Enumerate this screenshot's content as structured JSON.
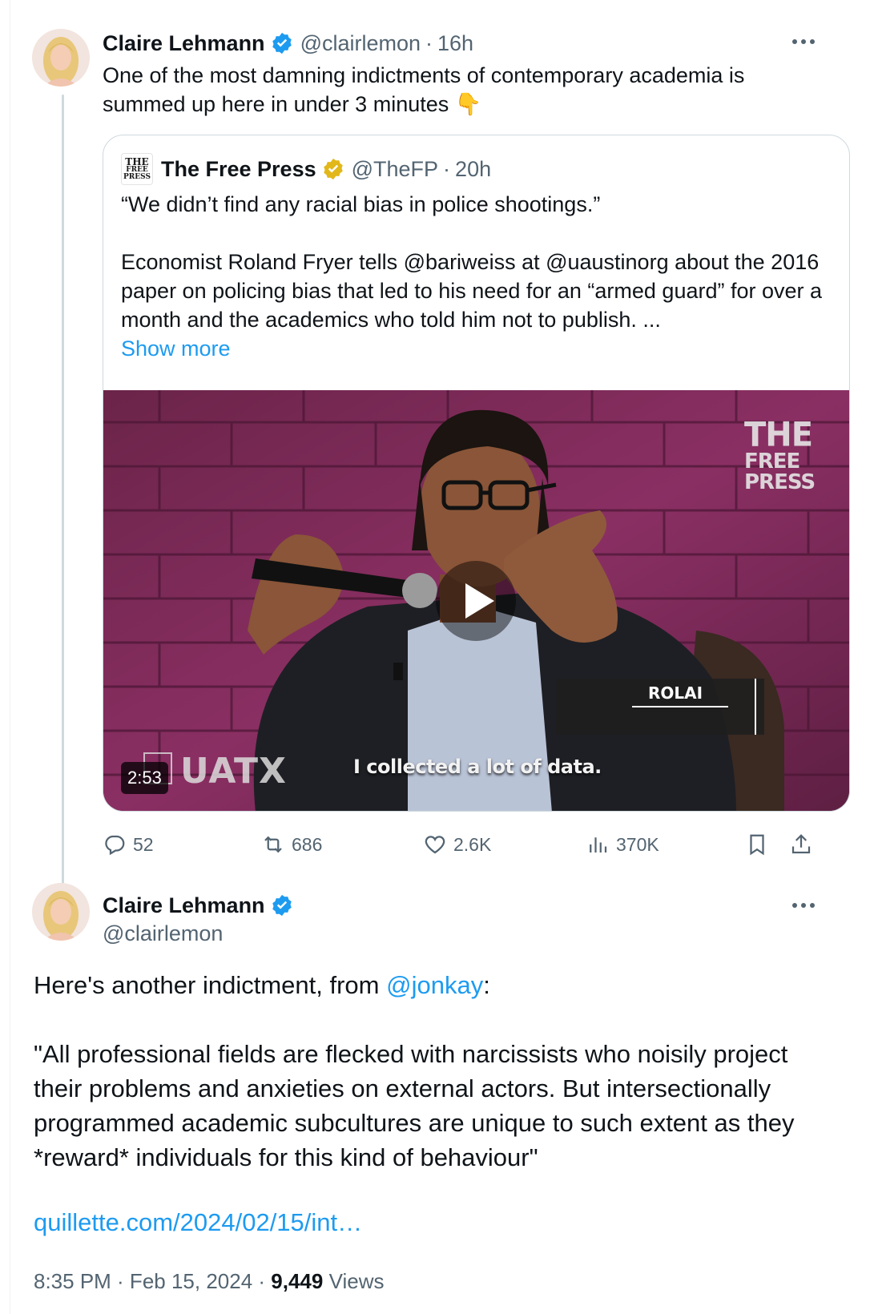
{
  "tweet1": {
    "author_name": "Claire Lehmann",
    "handle": "@clairlemon",
    "separator": "·",
    "time": "16h",
    "text": "One of the most damning indictments of contemporary academia is summed up here in under 3 minutes 👇",
    "quote": {
      "logo_lines": [
        "THE",
        "FREE",
        "PRESS"
      ],
      "author_name": "The Free Press",
      "handle": "@TheFP",
      "time": "20h",
      "text_line1": "“We didn’t find any racial bias in police shootings.”",
      "text_para2": "Economist Roland Fryer tells @bariweiss at @uaustinorg about the 2016 paper on policing bias that led to his need for an “armed guard” for over a month and the academics who told him not to publish. ...",
      "show_more": "Show more",
      "video": {
        "duration": "2:53",
        "watermark_lines": [
          "THE",
          "FREE",
          "PRESS"
        ],
        "org_logo": "UATX",
        "caption": "I collected a lot of data.",
        "lower_third": "ROLAI"
      }
    },
    "actions": {
      "replies": "52",
      "reposts": "686",
      "likes": "2.6K",
      "views": "370K"
    }
  },
  "tweet2": {
    "author_name": "Claire Lehmann",
    "handle": "@clairlemon",
    "body_prefix": "Here's another indictment, from ",
    "mention": "@jonkay",
    "body_suffix": ":",
    "quote_text": "\"All professional fields are flecked with narcissists who noisily project their problems and anxieties on external actors. But intersectionally programmed academic subcultures are unique to such extent as they *reward* individuals for this kind of behaviour\"",
    "link": "quillette.com/2024/02/15/int…",
    "timestamp": "8:35 PM · Feb 15, 2024 · ",
    "views_count": "9,449",
    "views_label": " Views"
  },
  "colors": {
    "accent": "#1d9bf0",
    "secondary_text": "#536471",
    "gold_badge": "#e2b719"
  },
  "icons": [
    "verified-icon",
    "gold-verified-icon",
    "more-icon",
    "reply-icon",
    "repost-icon",
    "like-icon",
    "views-icon",
    "bookmark-icon",
    "share-icon",
    "play-icon"
  ]
}
